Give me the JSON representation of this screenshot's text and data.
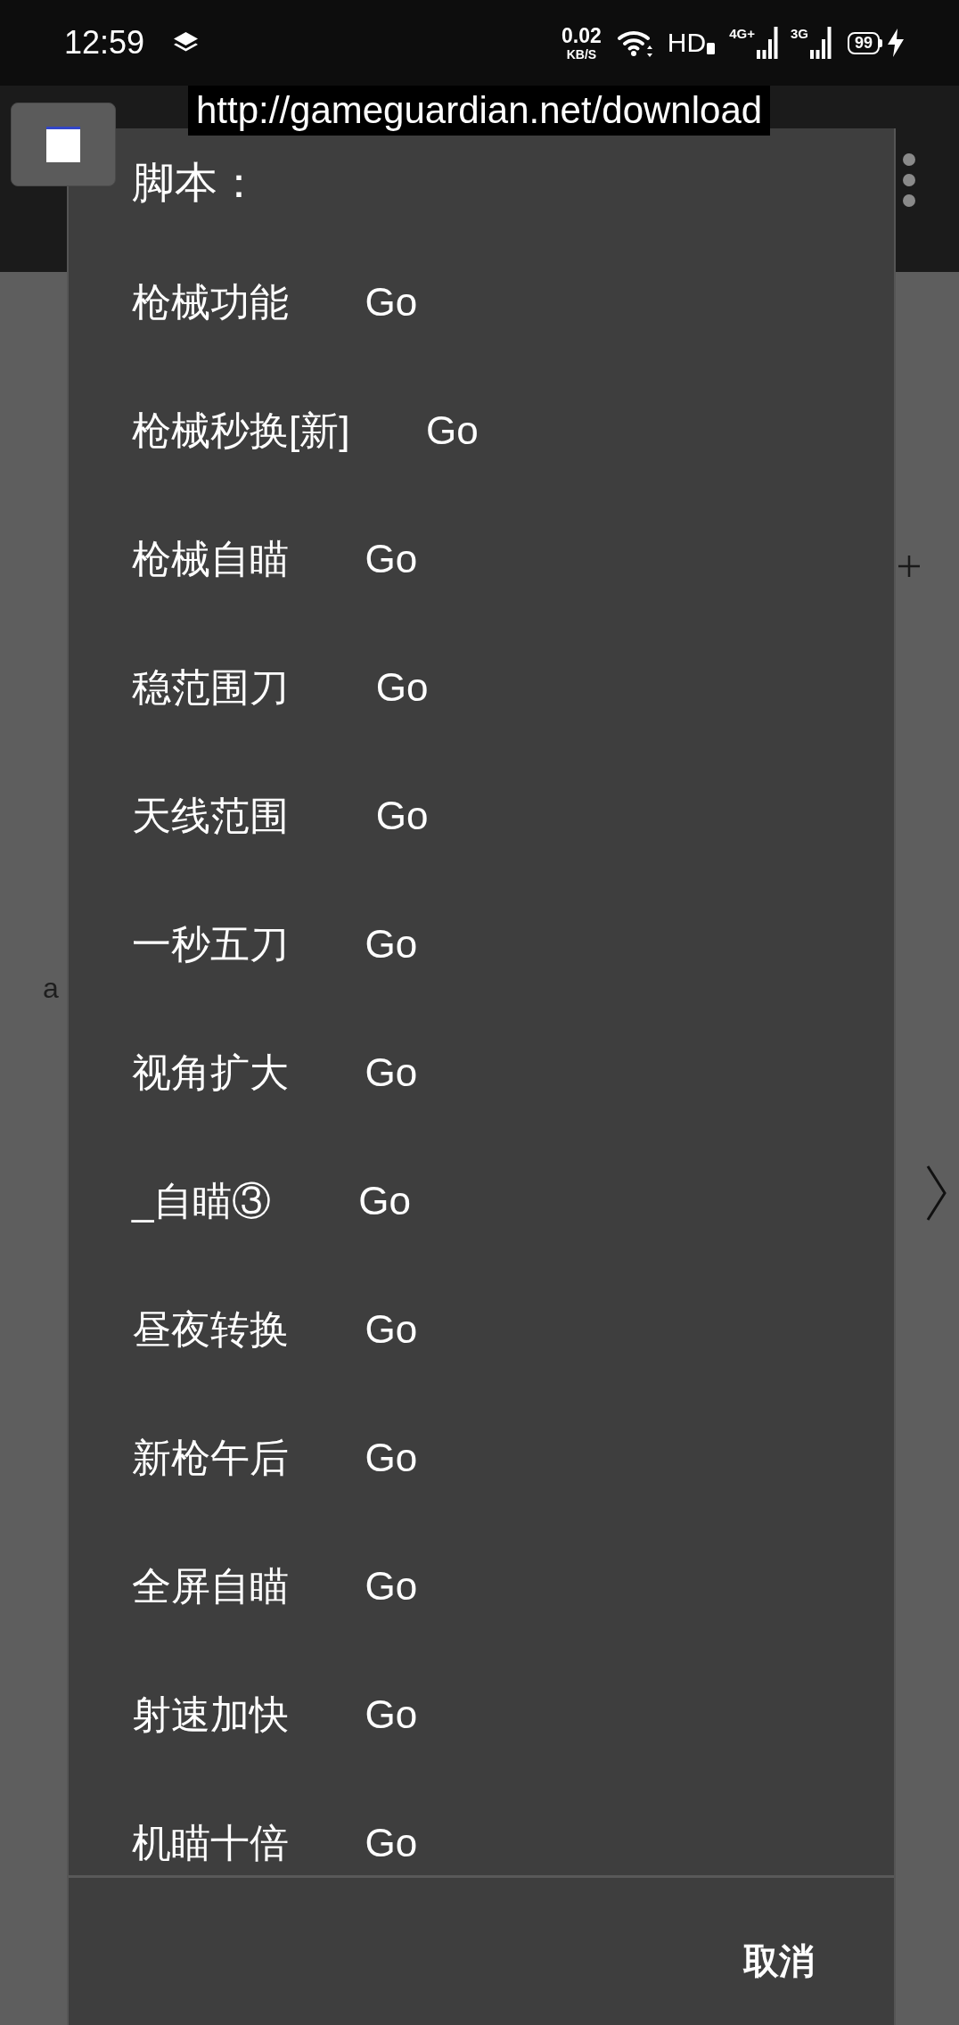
{
  "status_bar": {
    "time": "12:59",
    "network_speed": {
      "value": "0.02",
      "unit": "KB/S"
    },
    "hd_label": "HD",
    "signals": [
      {
        "label": "4G+"
      },
      {
        "label": "3G"
      }
    ],
    "battery": "99"
  },
  "url_banner": "http://gameguardian.net/download",
  "background_app": {
    "text_fragment": "a"
  },
  "dialog": {
    "title": "脚本：",
    "items": [
      {
        "label": "枪械功能       Go"
      },
      {
        "label": "枪械秒换[新]       Go"
      },
      {
        "label": "枪械自瞄       Go"
      },
      {
        "label": "稳范围刀        Go"
      },
      {
        "label": "天线范围        Go"
      },
      {
        "label": "一秒五刀       Go"
      },
      {
        "label": "视角扩大       Go"
      },
      {
        "label": "_自瞄③        Go"
      },
      {
        "label": "昼夜转换       Go"
      },
      {
        "label": "新枪午后       Go"
      },
      {
        "label": "全屏自瞄       Go"
      },
      {
        "label": "射速加快       Go"
      },
      {
        "label": "机瞄十倍       Go"
      }
    ],
    "cancel_button": "取消"
  }
}
